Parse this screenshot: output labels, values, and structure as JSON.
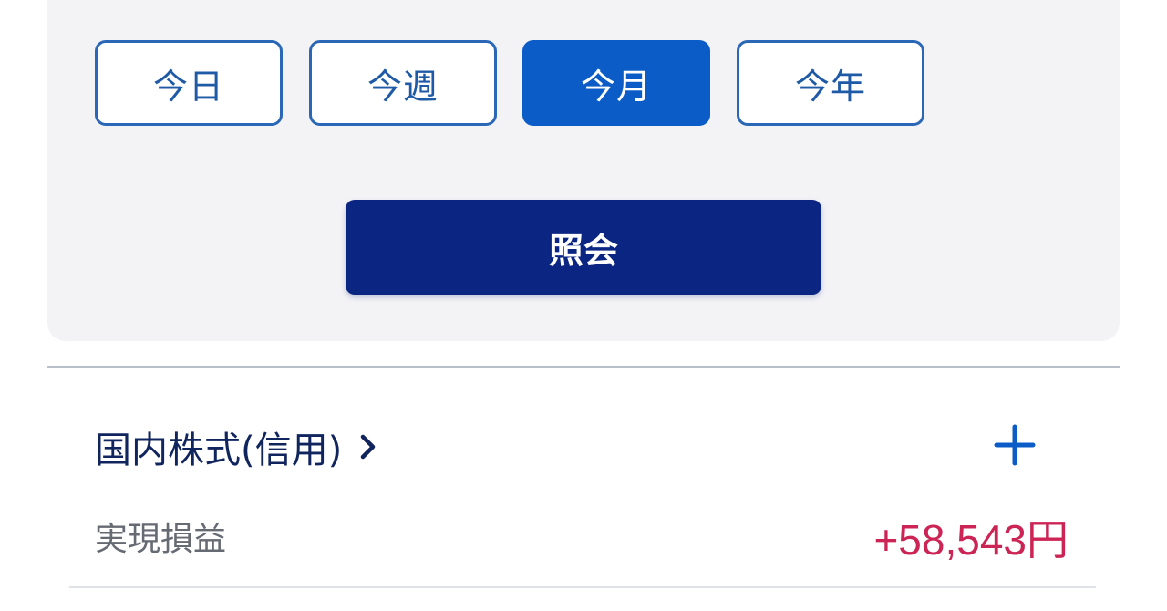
{
  "period_buttons": [
    {
      "label": "今日",
      "selected": false
    },
    {
      "label": "今週",
      "selected": false
    },
    {
      "label": "今月",
      "selected": true
    },
    {
      "label": "今年",
      "selected": false
    }
  ],
  "query_button": {
    "label": "照会"
  },
  "section": {
    "title": "国内株式(信用)",
    "chevron_icon": "chevron-right-icon",
    "expand_icon": "plus-icon"
  },
  "realized_pl": {
    "label": "実現損益",
    "value": "+58,543円"
  },
  "colors": {
    "panel_bg": "#f3f3f6",
    "button_border": "#2a67b6",
    "button_active": "#0b5cc7",
    "query_button": "#0a2582",
    "heading_text": "#10245e",
    "positive_value": "#cc2455"
  }
}
